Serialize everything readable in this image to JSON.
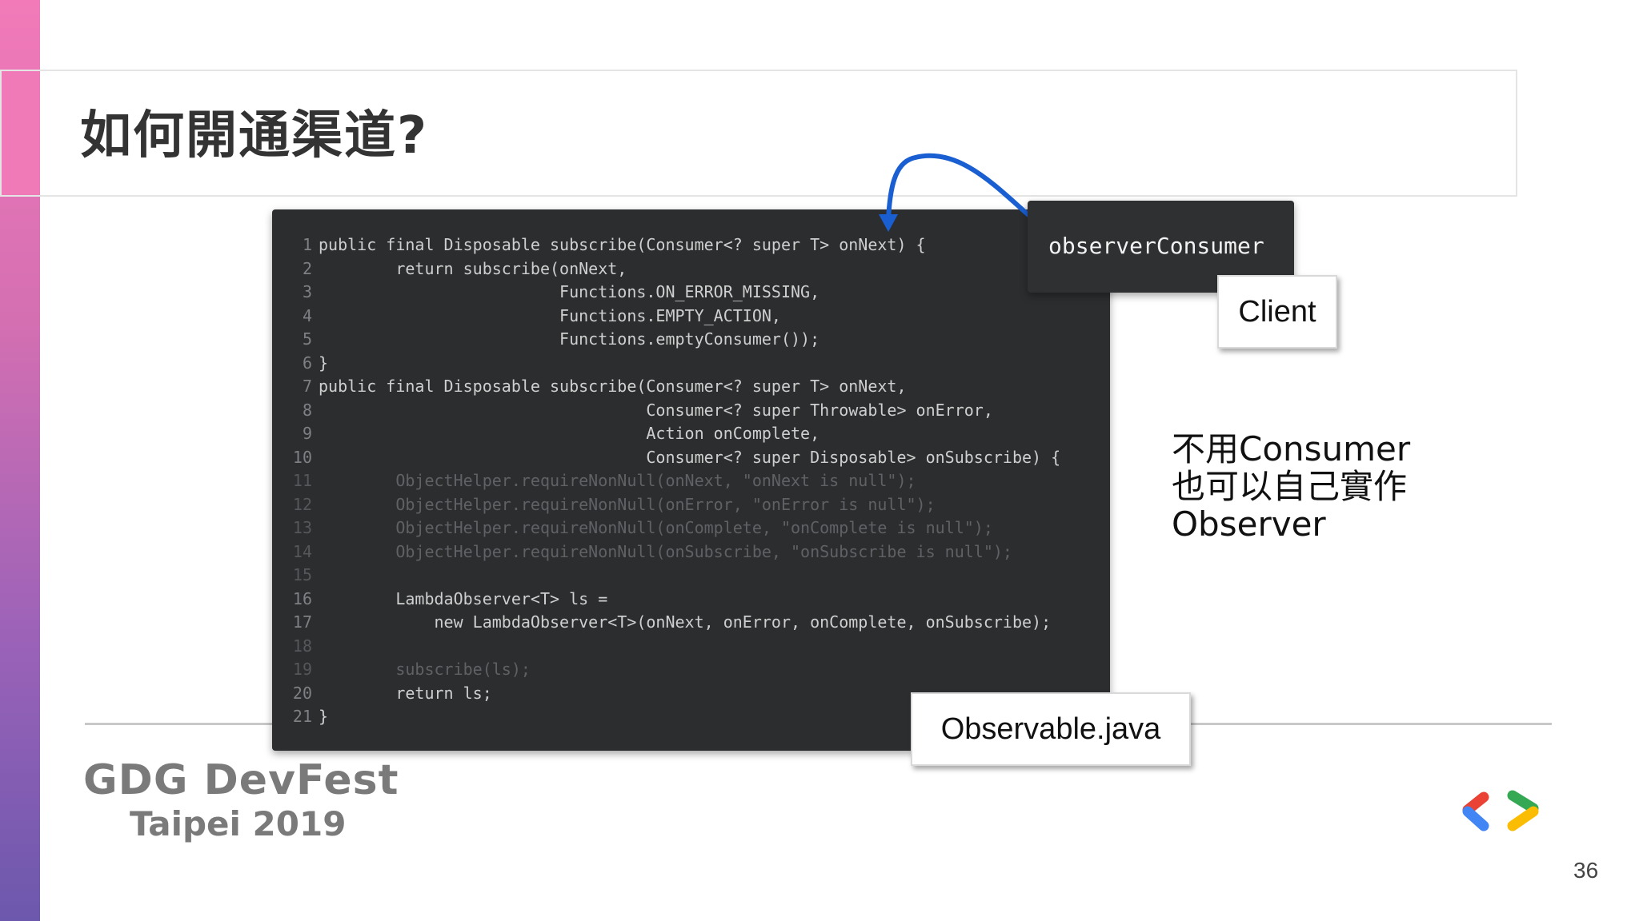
{
  "slide": {
    "title": "如何開通渠道?",
    "page_number": "36",
    "brand_line1": "GDG DevFest",
    "brand_line2": "Taipei 2019"
  },
  "code": {
    "lines": [
      {
        "n": "1",
        "text": "public final Disposable subscribe(Consumer<? super T> onNext) {",
        "faded": false
      },
      {
        "n": "2",
        "text": "        return subscribe(onNext,",
        "faded": false
      },
      {
        "n": "3",
        "text": "                         Functions.ON_ERROR_MISSING,",
        "faded": false
      },
      {
        "n": "4",
        "text": "                         Functions.EMPTY_ACTION,",
        "faded": false
      },
      {
        "n": "5",
        "text": "                         Functions.emptyConsumer());",
        "faded": false
      },
      {
        "n": "6",
        "text": "}",
        "faded": false
      },
      {
        "n": "7",
        "text": "public final Disposable subscribe(Consumer<? super T> onNext,",
        "faded": false
      },
      {
        "n": "8",
        "text": "                                  Consumer<? super Throwable> onError,",
        "faded": false
      },
      {
        "n": "9",
        "text": "                                  Action onComplete,",
        "faded": false
      },
      {
        "n": "10",
        "text": "                                  Consumer<? super Disposable> onSubscribe) {",
        "faded": false
      },
      {
        "n": "11",
        "text": "        ObjectHelper.requireNonNull(onNext, \"onNext is null\");",
        "faded": true
      },
      {
        "n": "12",
        "text": "        ObjectHelper.requireNonNull(onError, \"onError is null\");",
        "faded": true
      },
      {
        "n": "13",
        "text": "        ObjectHelper.requireNonNull(onComplete, \"onComplete is null\");",
        "faded": true
      },
      {
        "n": "14",
        "text": "        ObjectHelper.requireNonNull(onSubscribe, \"onSubscribe is null\");",
        "faded": true
      },
      {
        "n": "15",
        "text": "",
        "faded": true
      },
      {
        "n": "16",
        "text": "        LambdaObserver<T> ls =",
        "faded": false
      },
      {
        "n": "17",
        "text": "            new LambdaObserver<T>(onNext, onError, onComplete, onSubscribe);",
        "faded": false
      },
      {
        "n": "18",
        "text": "",
        "faded": true
      },
      {
        "n": "19",
        "text": "        subscribe(ls);",
        "faded": true
      },
      {
        "n": "20",
        "text": "        return ls;",
        "faded": false
      },
      {
        "n": "21",
        "text": "}",
        "faded": false
      }
    ]
  },
  "annotations": {
    "observer_tag": "observerConsumer",
    "client_label": "Client",
    "file_label": "Observable.java",
    "note_lines": [
      "不用Consumer",
      "也可以自己實作",
      "Observer"
    ]
  },
  "colors": {
    "code_bg": "#2b2d2f",
    "arrow": "#1a5fd1",
    "accent_pink": "#f07ab8",
    "accent_purple": "#6c58ad",
    "logo_blue": "#4285f4",
    "logo_red": "#ea4335",
    "logo_green": "#34a853",
    "logo_yellow": "#fbbc04"
  }
}
